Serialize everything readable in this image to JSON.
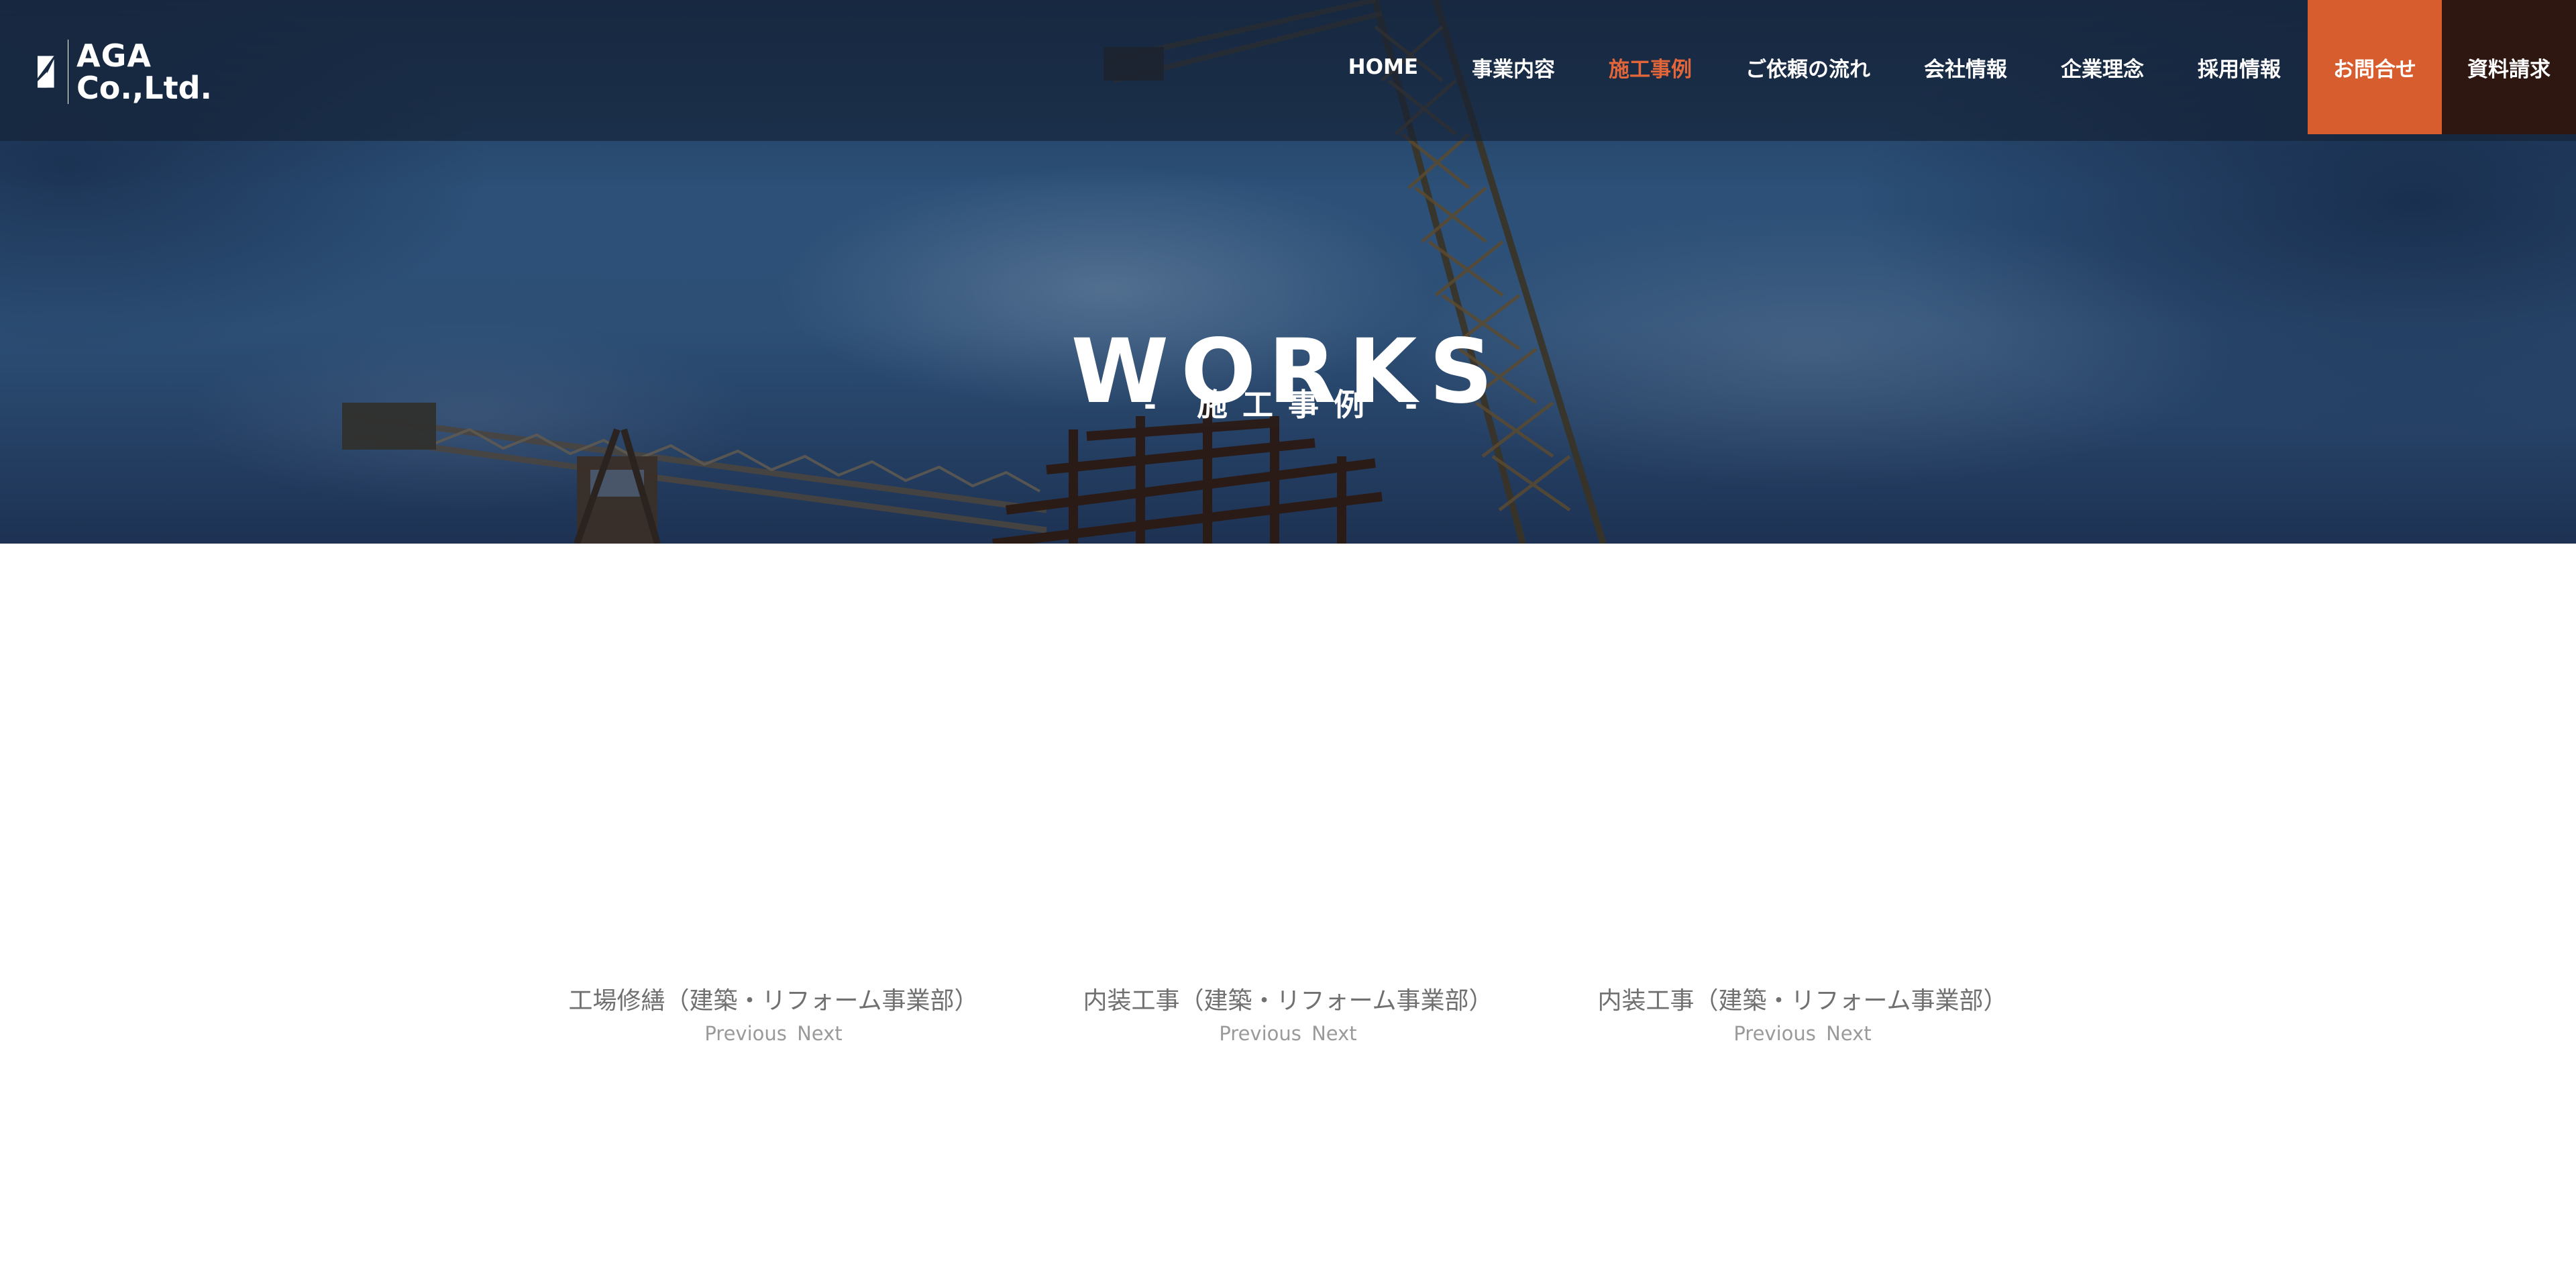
{
  "header": {
    "logo": {
      "line1": "AGA",
      "line2": "Co.,Ltd."
    },
    "nav": [
      {
        "label": "HOME",
        "active": false
      },
      {
        "label": "事業内容",
        "active": false
      },
      {
        "label": "施工事例",
        "active": true
      },
      {
        "label": "ご依頼の流れ",
        "active": false
      },
      {
        "label": "会社情報",
        "active": false
      },
      {
        "label": "企業理念",
        "active": false
      },
      {
        "label": "採用情報",
        "active": false
      }
    ],
    "contact_label": "お問合せ",
    "request_label": "資料請求"
  },
  "hero": {
    "title": "WORKS",
    "subtitle": "- 施工事例 -"
  },
  "works": [
    {
      "title": "工場修繕（建築・リフォーム事業部）",
      "prev": "Previous",
      "next": "Next"
    },
    {
      "title": "内装工事（建築・リフォーム事業部）",
      "prev": "Previous",
      "next": "Next"
    },
    {
      "title": "内装工事（建築・リフォーム事業部）",
      "prev": "Previous",
      "next": "Next"
    }
  ],
  "colors": {
    "accent": "#e2663a",
    "contact_bg": "#d85d2e",
    "request_bg": "#2e1710",
    "header_bg": "#142034"
  }
}
